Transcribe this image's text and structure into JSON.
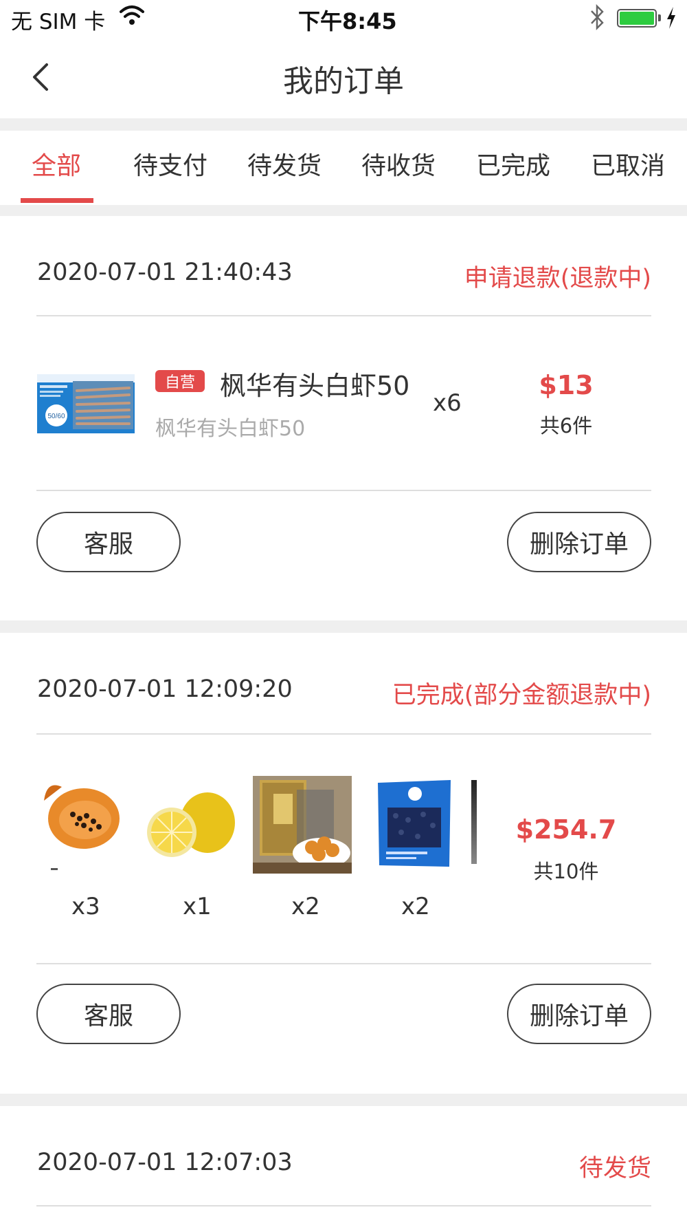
{
  "status_bar": {
    "carrier": "无 SIM 卡",
    "time": "下午8:45"
  },
  "nav": {
    "title": "我的订单"
  },
  "tabs": [
    {
      "label": "全部",
      "active": true
    },
    {
      "label": "待支付",
      "active": false
    },
    {
      "label": "待发货",
      "active": false
    },
    {
      "label": "待收货",
      "active": false
    },
    {
      "label": "已完成",
      "active": false
    },
    {
      "label": "已取消",
      "active": false
    }
  ],
  "orders": [
    {
      "time": "2020-07-01 21:40:43",
      "status": "申请退款(退款中)",
      "product": {
        "tag": "自营",
        "name": "枫华有头白虾50",
        "subtitle": "枫华有头白虾50",
        "qty": "x6",
        "image_label": "50/60"
      },
      "price": "$13",
      "count": "共6件",
      "buttons": {
        "service": "客服",
        "delete": "删除订单"
      }
    },
    {
      "time": "2020-07-01 12:09:20",
      "status": "已完成(部分金额退款中)",
      "items": [
        {
          "icon": "papaya-image",
          "qty": "x3"
        },
        {
          "icon": "lemon-image",
          "qty": "x1"
        },
        {
          "icon": "snack-bag-image",
          "qty": "x2"
        },
        {
          "icon": "blue-package-image",
          "qty": "x2"
        }
      ],
      "price": "$254.7",
      "count": "共10件",
      "buttons": {
        "service": "客服",
        "delete": "删除订单"
      }
    },
    {
      "time": "2020-07-01 12:07:03",
      "status": "待发货"
    }
  ],
  "colors": {
    "accent": "#e34a4a",
    "separator": "#efefef",
    "text": "#333333",
    "muted": "#aaaaaa"
  }
}
